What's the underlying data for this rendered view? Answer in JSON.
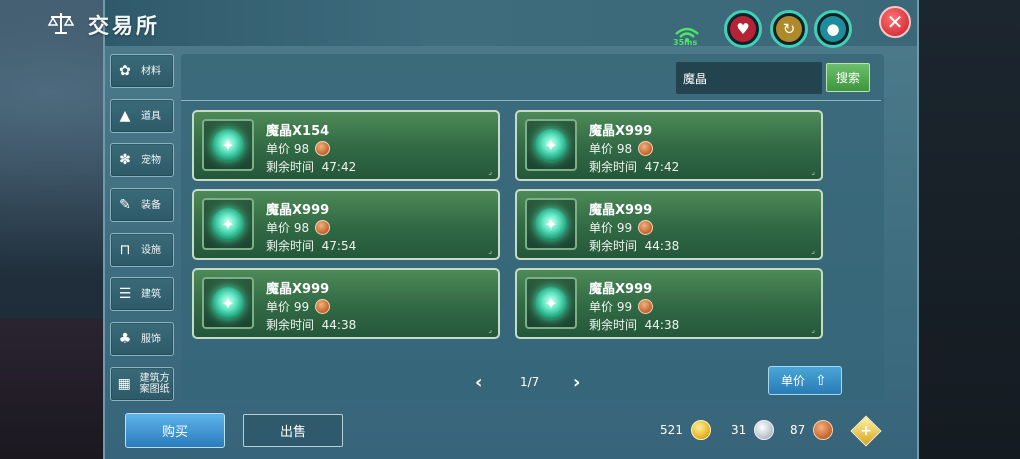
{
  "header": {
    "title": "交易所",
    "ping": "35ms"
  },
  "status_icons": [
    "heart-icon",
    "hunger-icon",
    "water-drop-icon"
  ],
  "sidebar": {
    "items": [
      {
        "label": "材料",
        "icon": "materials-icon"
      },
      {
        "label": "道具",
        "icon": "props-icon"
      },
      {
        "label": "宠物",
        "icon": "pet-paw-icon"
      },
      {
        "label": "装备",
        "icon": "equipment-icon"
      },
      {
        "label": "设施",
        "icon": "facility-icon"
      },
      {
        "label": "建筑",
        "icon": "building-icon"
      },
      {
        "label": "服饰",
        "icon": "clothing-icon"
      },
      {
        "label": "建筑方案图纸",
        "icon": "blueprint-icon"
      }
    ]
  },
  "search": {
    "value": "魔晶",
    "button_label": "搜索"
  },
  "listings": [
    {
      "name": "魔晶X154",
      "price_label": "单价",
      "price": "98",
      "time_label": "剩余时间",
      "time": "47:42"
    },
    {
      "name": "魔晶X999",
      "price_label": "单价",
      "price": "98",
      "time_label": "剩余时间",
      "time": "47:42"
    },
    {
      "name": "魔晶X999",
      "price_label": "单价",
      "price": "98",
      "time_label": "剩余时间",
      "time": "47:54"
    },
    {
      "name": "魔晶X999",
      "price_label": "单价",
      "price": "99",
      "time_label": "剩余时间",
      "time": "44:38"
    },
    {
      "name": "魔晶X999",
      "price_label": "单价",
      "price": "99",
      "time_label": "剩余时间",
      "time": "44:38"
    },
    {
      "name": "魔晶X999",
      "price_label": "单价",
      "price": "99",
      "time_label": "剩余时间",
      "time": "44:38"
    }
  ],
  "pagination": {
    "text": "1/7"
  },
  "sort": {
    "label": "单价"
  },
  "footer": {
    "buy_label": "购买",
    "sell_label": "出售",
    "currency": {
      "gold": "521",
      "silver": "31",
      "copper": "87"
    }
  },
  "colors": {
    "card_green": "#336b46",
    "search_button": "#4e9e4c",
    "buy_button": "#3a8ccb",
    "close_red": "#d42a36"
  }
}
